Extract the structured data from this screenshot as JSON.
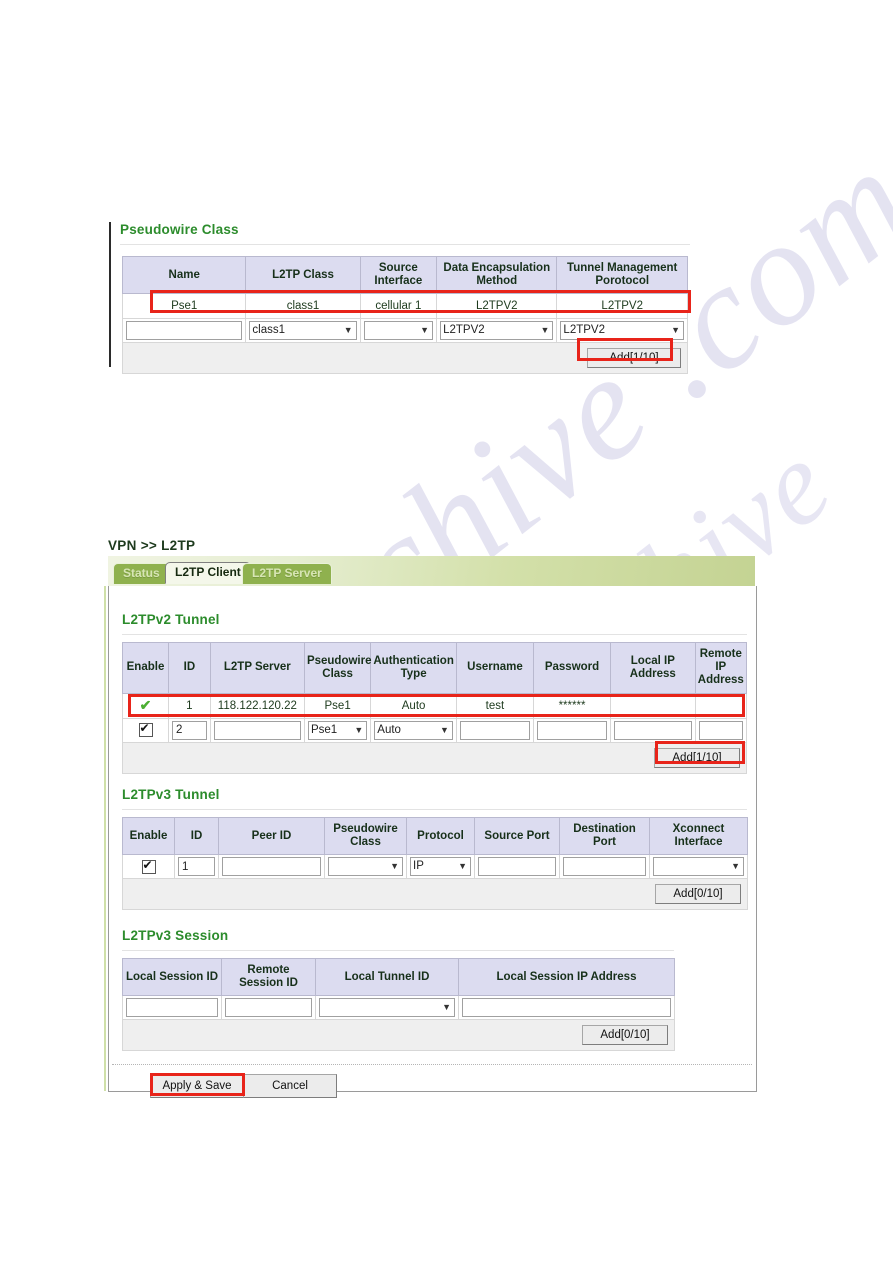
{
  "watermark": {
    "line1": "chive .com",
    "line2": "manualsarchive"
  },
  "pseudowire_section": {
    "title": "Pseudowire Class",
    "table": {
      "headers": [
        "Name",
        "L2TP Class",
        "Source Interface",
        "Data Encapsulation Method",
        "Tunnel Management Porotocol"
      ],
      "rows": [
        {
          "name": "Pse1",
          "l2tp_class": "class1",
          "source_interface": "cellular 1",
          "data_encapsulation": "L2TPV2",
          "tunnel_management": "L2TPV2"
        }
      ],
      "input_row": {
        "name_value": "",
        "l2tp_class_value": "class1",
        "source_interface_value": "",
        "data_encapsulation_value": "L2TPV2",
        "tunnel_management_value": "L2TPV2"
      },
      "add_button": "Add[1/10]"
    }
  },
  "header": {
    "breadcrumb": "VPN >> L2TP",
    "tabs": [
      {
        "label": "Status",
        "active": false
      },
      {
        "label": "L2TP Client",
        "active": true
      },
      {
        "label": "L2TP Server",
        "active": false
      }
    ]
  },
  "l2tpv2_tunnel": {
    "title": "L2TPv2 Tunnel",
    "headers": [
      "Enable",
      "ID",
      "L2TP Server",
      "Pseudowire Class",
      "Authentication Type",
      "Username",
      "Password",
      "Local IP Address",
      "Remote IP Address"
    ],
    "rows": [
      {
        "enable": "✔",
        "id": "1",
        "l2tp_server": "118.122.120.22",
        "pseudowire_class": "Pse1",
        "authentication_type": "Auto",
        "username": "test",
        "password": "******",
        "local_ip": "",
        "remote_ip": ""
      }
    ],
    "input_row": {
      "enable_checked": true,
      "id_value": "2",
      "l2tp_server_value": "",
      "pseudowire_class_value": "Pse1",
      "authentication_type_value": "Auto",
      "username_value": "",
      "password_value": "",
      "local_ip_value": "",
      "remote_ip_value": ""
    },
    "add_button": "Add[1/10]"
  },
  "l2tpv3_tunnel": {
    "title": "L2TPv3 Tunnel",
    "headers": [
      "Enable",
      "ID",
      "Peer ID",
      "Pseudowire Class",
      "Protocol",
      "Source Port",
      "Destination Port",
      "Xconnect Interface"
    ],
    "input_row": {
      "enable_checked": true,
      "id_value": "1",
      "peer_id_value": "",
      "pseudowire_class_value": "",
      "protocol_value": "IP",
      "source_port_value": "",
      "destination_port_value": "",
      "xconnect_interface_value": ""
    },
    "add_button": "Add[0/10]"
  },
  "l2tpv3_session": {
    "title": "L2TPv3 Session",
    "headers": [
      "Local Session ID",
      "Remote Session ID",
      "Local Tunnel ID",
      "Local Session IP Address"
    ],
    "input_row": {
      "local_session_id_value": "",
      "remote_session_id_value": "",
      "local_tunnel_id_value": "",
      "local_session_ip_value": ""
    },
    "add_button": "Add[0/10]"
  },
  "footer": {
    "apply_button": "Apply & Save",
    "cancel_button": "Cancel"
  },
  "colors": {
    "section_title": "#2c8c2c",
    "table_header_bg": "#dcdcf0",
    "annotation": "#e8241a",
    "tab_active_bg": "#f4f7ea",
    "tab_inactive_bg": "#8fb14e"
  }
}
